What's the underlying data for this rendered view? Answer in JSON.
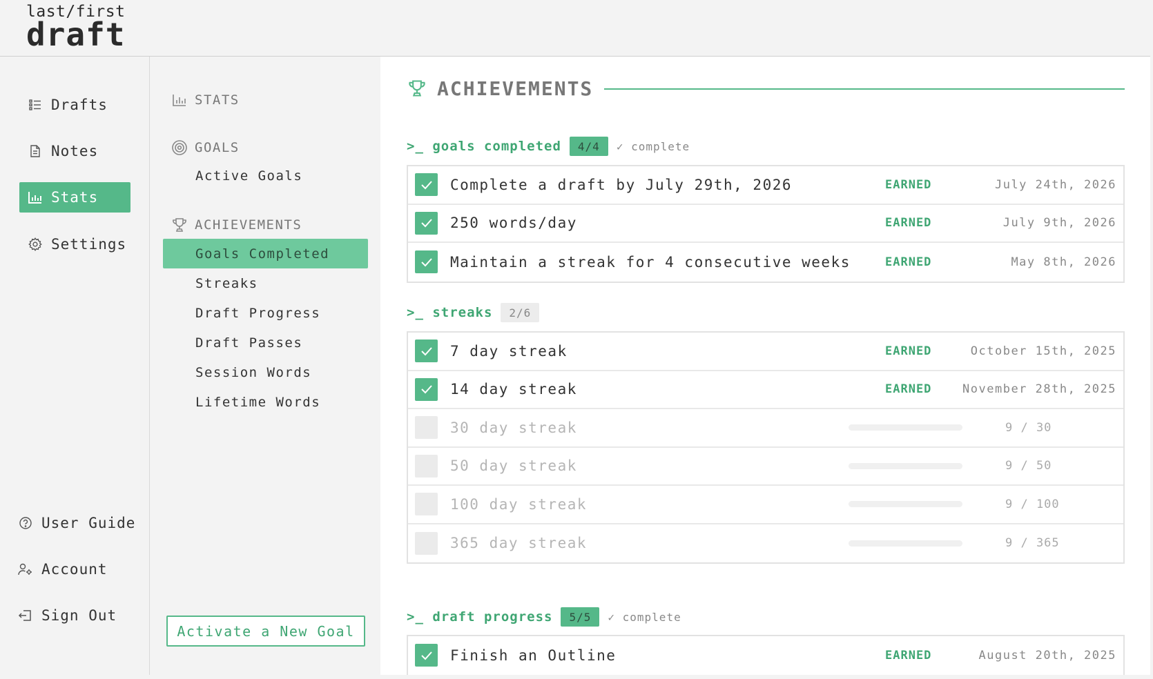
{
  "app": {
    "logo_line1": "last/first",
    "logo_line2": "draft"
  },
  "nav": {
    "items": [
      {
        "label": "Drafts",
        "icon": "list-icon"
      },
      {
        "label": "Notes",
        "icon": "document-icon"
      },
      {
        "label": "Stats",
        "icon": "bar-chart-icon",
        "active": true
      },
      {
        "label": "Settings",
        "icon": "gear-icon"
      }
    ],
    "bottom_items": [
      {
        "label": "User Guide",
        "icon": "help-icon"
      },
      {
        "label": "Account",
        "icon": "user-settings-icon"
      },
      {
        "label": "Sign Out",
        "icon": "sign-out-icon"
      }
    ]
  },
  "subnav": {
    "stats_heading": "STATS",
    "goals_heading": "GOALS",
    "goals_items": [
      "Active Goals"
    ],
    "achievements_heading": "ACHIEVEMENTS",
    "achievements_items": [
      "Goals Completed",
      "Streaks",
      "Draft Progress",
      "Draft Passes",
      "Session Words",
      "Lifetime Words"
    ],
    "active_item": "Goals Completed",
    "cta_label": "Activate a New Goal"
  },
  "main": {
    "title": "ACHIEVEMENTS",
    "groups": [
      {
        "title": ">_ goals completed",
        "badge": "4/4",
        "complete_note": "✓ complete",
        "rows": [
          {
            "text": "Complete a draft by July 29th, 2026",
            "status": "EARNED",
            "date": "July 24th, 2026"
          },
          {
            "text": "250 words/day",
            "status": "EARNED",
            "date": "July 9th, 2026"
          },
          {
            "text": "Maintain a streak for 4 consecutive weeks",
            "status": "EARNED",
            "date": "May 8th, 2026"
          }
        ]
      },
      {
        "title": ">_ streaks",
        "badge": "2/6",
        "rows": [
          {
            "text": "7 day streak",
            "status": "EARNED",
            "date": "October 15th, 2025"
          },
          {
            "text": "14 day streak",
            "status": "EARNED",
            "date": "November 28th, 2025"
          },
          {
            "text": "30 day streak",
            "progress_text": "9 / 30",
            "progress": 0.3
          },
          {
            "text": "50 day streak",
            "progress_text": "9 / 50",
            "progress": 0.18
          },
          {
            "text": "100 day streak",
            "progress_text": "9 / 100",
            "progress": 0.09
          },
          {
            "text": "365 day streak",
            "progress_text": "9 / 365",
            "progress": 0.025
          }
        ]
      },
      {
        "title": ">_ draft progress",
        "badge": "5/5",
        "complete_note": "✓ complete",
        "rows": [
          {
            "text": "Finish an Outline",
            "status": "EARNED",
            "date": "August 20th, 2025"
          }
        ]
      }
    ]
  },
  "colors": {
    "accent": "#55b889",
    "accent_light": "#6ec99d",
    "accent_text": "#3fa673"
  }
}
